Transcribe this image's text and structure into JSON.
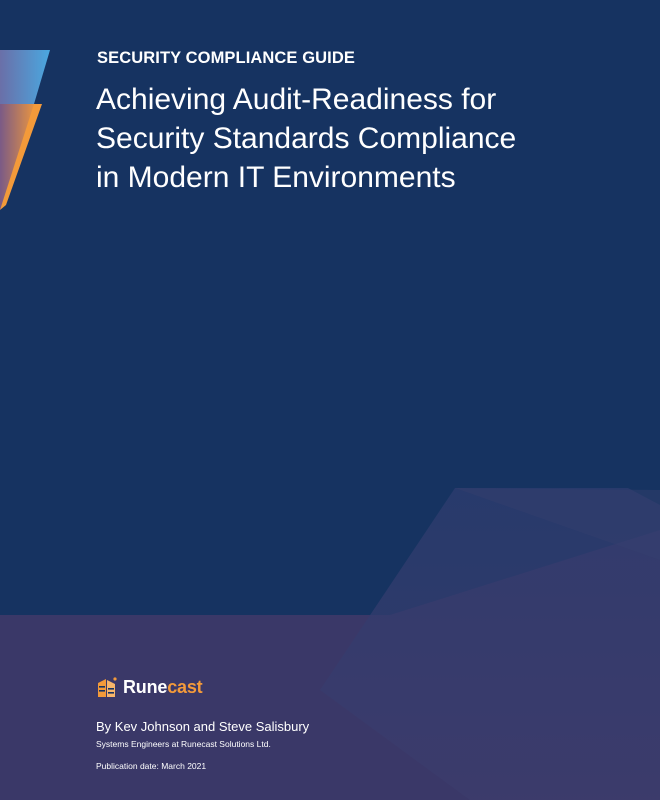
{
  "document": {
    "eyebrow": "SECURITY COMPLIANCE GUIDE",
    "title_lines": [
      "Achieving Audit-Readiness for",
      "Security Standards Compliance",
      "in Modern IT Environments"
    ],
    "brand": {
      "name_part1": "Rune",
      "name_part2": "cast",
      "icon": "runecast-logo-icon"
    },
    "authors": "By Kev Johnson and Steve Salisbury",
    "affiliation": "Systems Engineers at Runecast Solutions Ltd.",
    "publication_date": "Publication date: March 2021"
  },
  "colors": {
    "background": "#163361",
    "footer_band": "#3a3868",
    "accent_orange": "#f39a3a",
    "accent_blue": "#4aa8e0",
    "text": "#ffffff"
  }
}
